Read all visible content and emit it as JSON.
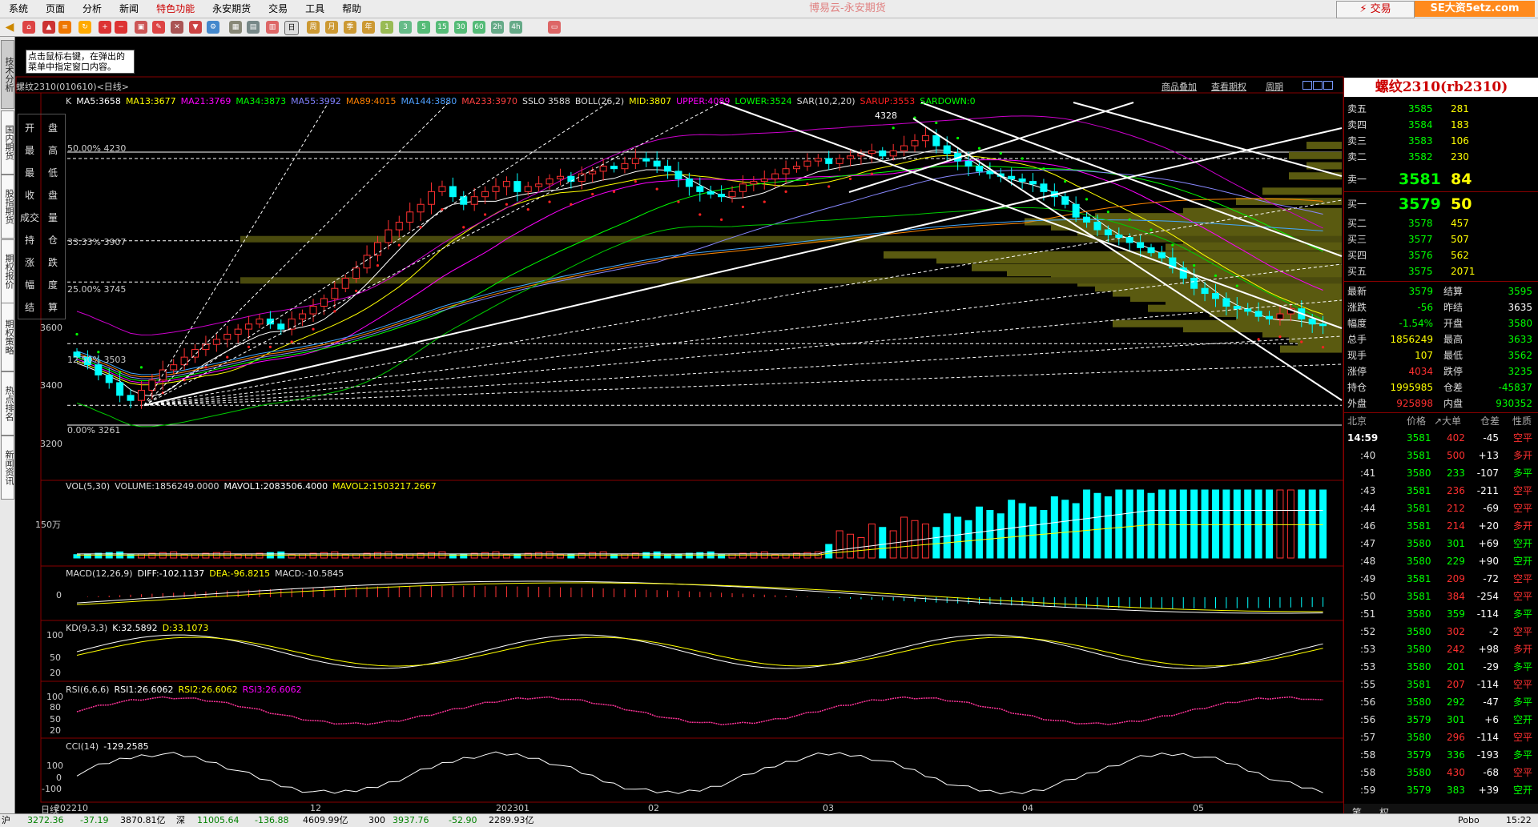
{
  "menu": {
    "items": [
      "系统",
      "页面",
      "分析",
      "新闻",
      "特色功能",
      "永安期货",
      "交易",
      "工具",
      "帮助"
    ],
    "active_index": 4,
    "window_title": "博易云-永安期货",
    "trade_button": "⚡ 交易",
    "brand": "SE大资5etz.com"
  },
  "toolbar": {
    "periods": [
      "周",
      "月",
      "季",
      "年",
      "1",
      "3",
      "5",
      "15",
      "30",
      "60",
      "2h",
      "4h"
    ]
  },
  "left_tabs": [
    "技术分析",
    "国内期货",
    "股指期货",
    "期权报价",
    "期权策略",
    "热点排名",
    "新闻资讯"
  ],
  "hint_text": "点击鼠标右键，在弹出的菜单中指定窗口内容。",
  "chart_header": {
    "title": "螺纹2310(010610)<日线>",
    "links": [
      "商品叠加",
      "查看期权",
      "周期"
    ]
  },
  "indicators": {
    "main": [
      {
        "text": "K",
        "color": "#dddddd"
      },
      {
        "text": "MA5:3658",
        "color": "#ffffff"
      },
      {
        "text": "MA13:3677",
        "color": "#ffff00"
      },
      {
        "text": "MA21:3769",
        "color": "#ff00ff"
      },
      {
        "text": "MA34:3873",
        "color": "#00ff00"
      },
      {
        "text": "MA55:3992",
        "color": "#8080ff"
      },
      {
        "text": "MA89:4015",
        "color": "#ff8000"
      },
      {
        "text": "MA144:3880",
        "color": "#4fa0ff"
      },
      {
        "text": "MA233:3970",
        "color": "#ff4040"
      },
      {
        "text": "SSLO 3588",
        "color": "#dddddd"
      },
      {
        "text": "BOLL(26,2)",
        "color": "#dddddd"
      },
      {
        "text": "MID:3807",
        "color": "#ffff00"
      },
      {
        "text": "UPPER:4089",
        "color": "#ff00ff"
      },
      {
        "text": "LOWER:3524",
        "color": "#00ff00"
      },
      {
        "text": "SAR(10,2,20)",
        "color": "#dddddd"
      },
      {
        "text": "SARUP:3553",
        "color": "#ff2020"
      },
      {
        "text": "SARDOWN:0",
        "color": "#00ff00"
      }
    ],
    "vol": [
      {
        "text": "VOL(5,30)",
        "color": "#dddddd"
      },
      {
        "text": "VOLUME:1856249.0000",
        "color": "#dddddd"
      },
      {
        "text": "MAVOL1:2083506.4000",
        "color": "#ffffff"
      },
      {
        "text": "MAVOL2:1503217.2667",
        "color": "#ffff00"
      }
    ],
    "macd": [
      {
        "text": "MACD(12,26,9)",
        "color": "#dddddd"
      },
      {
        "text": "DIFF:-102.1137",
        "color": "#ffffff"
      },
      {
        "text": "DEA:-96.8215",
        "color": "#ffff00"
      },
      {
        "text": "MACD:-10.5845",
        "color": "#dddddd"
      }
    ],
    "kd": [
      {
        "text": "KD(9,3,3)",
        "color": "#dddddd"
      },
      {
        "text": "K:32.5892",
        "color": "#ffffff"
      },
      {
        "text": "D:33.1073",
        "color": "#ffff00"
      }
    ],
    "rsi": [
      {
        "text": "RSI(6,6,6)",
        "color": "#dddddd"
      },
      {
        "text": "RSI1:26.6062",
        "color": "#ffffff"
      },
      {
        "text": "RSI2:26.6062",
        "color": "#ffff00"
      },
      {
        "text": "RSI3:26.6062",
        "color": "#ff00ff"
      }
    ],
    "cci": [
      {
        "text": "CCI(14)",
        "color": "#dddddd"
      },
      {
        "text": "-129.2585",
        "color": "#ffffff"
      }
    ]
  },
  "left_buttons": [
    "开",
    "盘",
    "最",
    "高",
    "最",
    "低",
    "收",
    "盘",
    "成交",
    "量",
    "持",
    "仓",
    "涨",
    "跌",
    "幅",
    "度",
    "结",
    "算"
  ],
  "price_axis": [
    "3600",
    "3400",
    "3200"
  ],
  "fib_labels": [
    "50.00% 4230",
    "33.33% 3907",
    "25.00% 3745",
    "12.50% 3503",
    "0.00% 3261"
  ],
  "high_label": "4328",
  "vol_axis": "150万",
  "macd_axis": "0",
  "kd_axis": [
    "100",
    "50",
    "20"
  ],
  "rsi_axis": [
    "100",
    "80",
    "50",
    "20"
  ],
  "cci_axis": [
    "100",
    "0",
    "-100"
  ],
  "dates": [
    {
      "label": "日线",
      "x": 0
    },
    {
      "label": "202210",
      "x": 17
    },
    {
      "label": "12",
      "x": 336
    },
    {
      "label": "202301",
      "x": 568
    },
    {
      "label": "02",
      "x": 758
    },
    {
      "label": "03",
      "x": 976
    },
    {
      "label": "04",
      "x": 1225
    },
    {
      "label": "05",
      "x": 1438
    }
  ],
  "quote": {
    "title": "螺纹2310(rb2310)",
    "sell": [
      {
        "label": "卖五",
        "price": "3585",
        "vol": "281"
      },
      {
        "label": "卖四",
        "price": "3584",
        "vol": "183"
      },
      {
        "label": "卖三",
        "price": "3583",
        "vol": "106"
      },
      {
        "label": "卖二",
        "price": "3582",
        "vol": "230"
      }
    ],
    "sell1": {
      "label": "卖一",
      "price": "3581",
      "vol": "84"
    },
    "buy1": {
      "label": "买一",
      "price": "3579",
      "vol": "50"
    },
    "buy": [
      {
        "label": "买二",
        "price": "3578",
        "vol": "457"
      },
      {
        "label": "买三",
        "price": "3577",
        "vol": "507"
      },
      {
        "label": "买四",
        "price": "3576",
        "vol": "562"
      },
      {
        "label": "买五",
        "price": "3575",
        "vol": "2071"
      }
    ],
    "stats": [
      {
        "l1": "最新",
        "v1": "3579",
        "c1": "#00ff00",
        "l2": "结算",
        "v2": "3595",
        "c2": "#00ff00"
      },
      {
        "l1": "涨跌",
        "v1": "-56",
        "c1": "#00ff00",
        "l2": "昨结",
        "v2": "3635",
        "c2": "#ffffff"
      },
      {
        "l1": "幅度",
        "v1": "-1.54%",
        "c1": "#00ff00",
        "l2": "开盘",
        "v2": "3580",
        "c2": "#00ff00"
      },
      {
        "l1": "总手",
        "v1": "1856249",
        "c1": "#ffff00",
        "l2": "最高",
        "v2": "3633",
        "c2": "#00ff00"
      },
      {
        "l1": "现手",
        "v1": "107",
        "c1": "#ffff00",
        "l2": "最低",
        "v2": "3562",
        "c2": "#00ff00"
      },
      {
        "l1": "涨停",
        "v1": "4034",
        "c1": "#ff3030",
        "l2": "跌停",
        "v2": "3235",
        "c2": "#00ff00"
      },
      {
        "l1": "持仓",
        "v1": "1995985",
        "c1": "#ffff00",
        "l2": "仓差",
        "v2": "-45837",
        "c2": "#00ff00"
      },
      {
        "l1": "外盘",
        "v1": "925898",
        "c1": "#ff3030",
        "l2": "内盘",
        "v2": "930352",
        "c2": "#00ff00"
      }
    ],
    "tick_header": [
      "北京",
      "价格",
      "↗大单",
      "仓差",
      "性质"
    ],
    "ticks": [
      {
        "t": "14:59",
        "p": "3581",
        "v": "402",
        "d": "-45",
        "n": "空平",
        "pc": "#00ff00",
        "vc": "#ff3030",
        "dc": "#ffffff",
        "nc": "#ff3030"
      },
      {
        "t": ":40",
        "p": "3581",
        "v": "500",
        "d": "+13",
        "n": "多开",
        "pc": "#00ff00",
        "vc": "#ff3030",
        "dc": "#ffffff",
        "nc": "#ff3030"
      },
      {
        "t": ":41",
        "p": "3580",
        "v": "233",
        "d": "-107",
        "n": "多平",
        "pc": "#00ff00",
        "vc": "#00ff00",
        "dc": "#ffffff",
        "nc": "#00ff00"
      },
      {
        "t": ":43",
        "p": "3581",
        "v": "236",
        "d": "-211",
        "n": "空平",
        "pc": "#00ff00",
        "vc": "#ff3030",
        "dc": "#ffffff",
        "nc": "#ff3030"
      },
      {
        "t": ":44",
        "p": "3581",
        "v": "212",
        "d": "-69",
        "n": "空平",
        "pc": "#00ff00",
        "vc": "#ff3030",
        "dc": "#ffffff",
        "nc": "#ff3030"
      },
      {
        "t": ":46",
        "p": "3581",
        "v": "214",
        "d": "+20",
        "n": "多开",
        "pc": "#00ff00",
        "vc": "#ff3030",
        "dc": "#ffffff",
        "nc": "#ff3030"
      },
      {
        "t": ":47",
        "p": "3580",
        "v": "301",
        "d": "+69",
        "n": "空开",
        "pc": "#00ff00",
        "vc": "#00ff00",
        "dc": "#ffffff",
        "nc": "#00ff00"
      },
      {
        "t": ":48",
        "p": "3580",
        "v": "229",
        "d": "+90",
        "n": "空开",
        "pc": "#00ff00",
        "vc": "#00ff00",
        "dc": "#ffffff",
        "nc": "#00ff00"
      },
      {
        "t": ":49",
        "p": "3581",
        "v": "209",
        "d": "-72",
        "n": "空平",
        "pc": "#00ff00",
        "vc": "#ff3030",
        "dc": "#ffffff",
        "nc": "#ff3030"
      },
      {
        "t": ":50",
        "p": "3581",
        "v": "384",
        "d": "-254",
        "n": "空平",
        "pc": "#00ff00",
        "vc": "#ff3030",
        "dc": "#ffffff",
        "nc": "#ff3030"
      },
      {
        "t": ":51",
        "p": "3580",
        "v": "359",
        "d": "-114",
        "n": "多平",
        "pc": "#00ff00",
        "vc": "#00ff00",
        "dc": "#ffffff",
        "nc": "#00ff00"
      },
      {
        "t": ":52",
        "p": "3580",
        "v": "302",
        "d": "-2",
        "n": "空平",
        "pc": "#00ff00",
        "vc": "#ff3030",
        "dc": "#ffffff",
        "nc": "#ff3030"
      },
      {
        "t": ":53",
        "p": "3580",
        "v": "242",
        "d": "+98",
        "n": "多开",
        "pc": "#00ff00",
        "vc": "#ff3030",
        "dc": "#ffffff",
        "nc": "#ff3030"
      },
      {
        "t": ":53",
        "p": "3580",
        "v": "201",
        "d": "-29",
        "n": "多平",
        "pc": "#00ff00",
        "vc": "#00ff00",
        "dc": "#ffffff",
        "nc": "#00ff00"
      },
      {
        "t": ":55",
        "p": "3581",
        "v": "207",
        "d": "-114",
        "n": "空平",
        "pc": "#00ff00",
        "vc": "#ff3030",
        "dc": "#ffffff",
        "nc": "#ff3030"
      },
      {
        "t": ":56",
        "p": "3580",
        "v": "292",
        "d": "-47",
        "n": "多平",
        "pc": "#00ff00",
        "vc": "#00ff00",
        "dc": "#ffffff",
        "nc": "#00ff00"
      },
      {
        "t": ":56",
        "p": "3579",
        "v": "301",
        "d": "+6",
        "n": "空开",
        "pc": "#00ff00",
        "vc": "#00ff00",
        "dc": "#ffffff",
        "nc": "#00ff00"
      },
      {
        "t": ":57",
        "p": "3580",
        "v": "296",
        "d": "-114",
        "n": "空平",
        "pc": "#00ff00",
        "vc": "#ff3030",
        "dc": "#ffffff",
        "nc": "#ff3030"
      },
      {
        "t": ":58",
        "p": "3579",
        "v": "336",
        "d": "-193",
        "n": "多平",
        "pc": "#00ff00",
        "vc": "#00ff00",
        "dc": "#ffffff",
        "nc": "#00ff00"
      },
      {
        "t": ":58",
        "p": "3580",
        "v": "430",
        "d": "-68",
        "n": "空平",
        "pc": "#00ff00",
        "vc": "#ff3030",
        "dc": "#ffffff",
        "nc": "#ff3030"
      },
      {
        "t": ":59",
        "p": "3579",
        "v": "383",
        "d": "+39",
        "n": "空开",
        "pc": "#00ff00",
        "vc": "#00ff00",
        "dc": "#ffffff",
        "nc": "#00ff00"
      }
    ],
    "tabs": [
      "笔",
      "权"
    ]
  },
  "statusbar": [
    {
      "text": "沪",
      "c": "#000000"
    },
    {
      "text": "3272.36",
      "c": "#008000"
    },
    {
      "text": "-37.19",
      "c": "#008000"
    },
    {
      "text": "3870.81亿",
      "c": "#000000"
    },
    {
      "text": "深",
      "c": "#000000"
    },
    {
      "text": "11005.64",
      "c": "#008000"
    },
    {
      "text": "-136.88",
      "c": "#008000"
    },
    {
      "text": "4609.99亿",
      "c": "#000000"
    },
    {
      "text": "300",
      "c": "#000000"
    },
    {
      "text": "3937.76",
      "c": "#008000"
    },
    {
      "text": "-52.90",
      "c": "#008000"
    },
    {
      "text": "2289.93亿",
      "c": "#000000"
    },
    {
      "text": "Pobo",
      "c": "#000000"
    },
    {
      "text": "15:22",
      "c": "#000000"
    }
  ],
  "chart_data": {
    "type": "candlestick",
    "title": "螺纹2310(010610)<日线>",
    "y_range": [
      3200,
      4400
    ],
    "x_labels": [
      "202210",
      "12",
      "202301",
      "02",
      "03",
      "04",
      "05"
    ],
    "closes": [
      3450,
      3420,
      3380,
      3350,
      3300,
      3280,
      3320,
      3360,
      3400,
      3420,
      3450,
      3480,
      3500,
      3520,
      3540,
      3560,
      3580,
      3600,
      3580,
      3560,
      3600,
      3620,
      3650,
      3680,
      3720,
      3760,
      3800,
      3850,
      3900,
      3950,
      3980,
      4020,
      4050,
      4100,
      4120,
      4080,
      4050,
      4080,
      4100,
      4120,
      4140,
      4100,
      4120,
      4130,
      4150,
      4160,
      4140,
      4170,
      4180,
      4200,
      4190,
      4210,
      4230,
      4220,
      4200,
      4180,
      4150,
      4120,
      4100,
      4090,
      4080,
      4100,
      4130,
      4140,
      4150,
      4170,
      4190,
      4200,
      4220,
      4230,
      4210,
      4230,
      4240,
      4250,
      4260,
      4240,
      4260,
      4280,
      4300,
      4320,
      4280,
      4250,
      4220,
      4200,
      4180,
      4170,
      4160,
      4150,
      4140,
      4130,
      4100,
      4080,
      4050,
      4000,
      3980,
      3950,
      3930,
      3920,
      3900,
      3880,
      3860,
      3840,
      3800,
      3760,
      3720,
      3700,
      3680,
      3650,
      3640,
      3630,
      3610,
      3600,
      3620,
      3640,
      3600,
      3580,
      3579
    ],
    "fib_levels": [
      {
        "pct": "50.00%",
        "price": 4230
      },
      {
        "pct": "33.33%",
        "price": 3907
      },
      {
        "pct": "25.00%",
        "price": 3745
      },
      {
        "pct": "12.50%",
        "price": 3503
      },
      {
        "pct": "0.00%",
        "price": 3261
      }
    ],
    "high": 4328,
    "boll": {
      "mid": 3807,
      "upper": 4089,
      "lower": 3524
    }
  }
}
